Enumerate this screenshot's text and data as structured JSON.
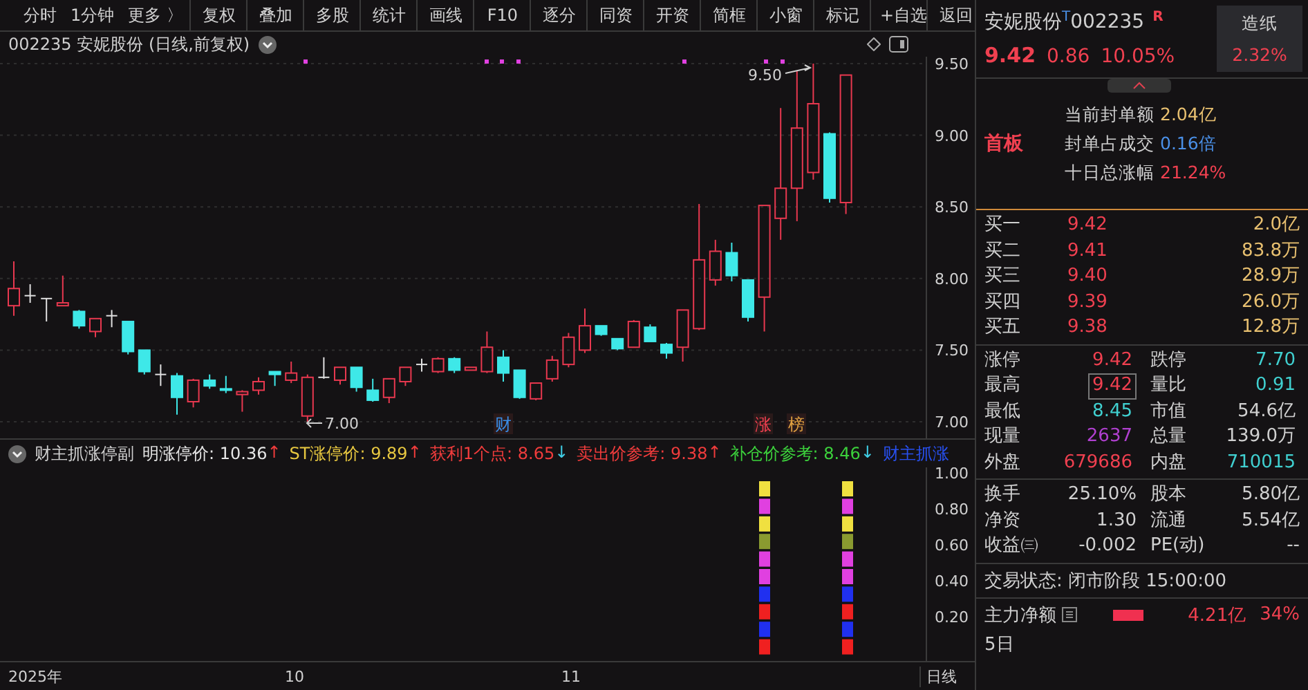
{
  "toolbar": {
    "tabs": [
      {
        "label": "分时",
        "selected": false
      },
      {
        "label": "1分钟",
        "selected": false
      },
      {
        "label": "更多 〉",
        "selected": false
      }
    ],
    "buttons": [
      "复权",
      "叠加",
      "多股",
      "统计",
      "画线",
      "F10",
      "逐分",
      "同资",
      "开资",
      "简框",
      "小窗",
      "标记",
      "+自选",
      "返回"
    ]
  },
  "chart": {
    "title": "002235 安妮股份 (日线,前复权)",
    "price_ticks": [
      "9.50",
      "9.00",
      "8.50",
      "8.00",
      "7.50",
      "7.00"
    ],
    "high_label": "9.50",
    "low_label": "7.00",
    "markers": [
      {
        "text": "财",
        "color": "#3a8ee8"
      },
      {
        "text": "涨",
        "color": "#f04050"
      },
      {
        "text": "榜",
        "color": "#e0a040"
      }
    ]
  },
  "indicator": {
    "name": "财主抓涨停副",
    "ticks": [
      "1.00",
      "0.80",
      "0.60",
      "0.40",
      "0.20"
    ],
    "items": [
      {
        "label": "明涨停价: 10.36",
        "arrow": {
          "text": "↑",
          "color": "#f03c3c"
        },
        "color": "#e6e6e6"
      },
      {
        "label": "ST涨停价: 9.89",
        "arrow": {
          "text": "↑",
          "color": "#f03c3c"
        },
        "color": "#e8c840"
      },
      {
        "label": "获利1个点: 8.65",
        "arrow": {
          "text": "↓",
          "color": "#40d0e8"
        },
        "color": "#f03c3c"
      },
      {
        "label": "卖出价参考: 9.38",
        "arrow": {
          "text": "↑",
          "color": "#f03c3c"
        },
        "color": "#f03c3c"
      },
      {
        "label": "补仓价参考: 8.46",
        "arrow": {
          "text": "↓",
          "color": "#40d0e8"
        },
        "color": "#3cd23c"
      },
      {
        "label": "财主抓涨",
        "color": "#2850f0"
      }
    ]
  },
  "date_axis": [
    "2025年",
    "10",
    "11"
  ],
  "period": "日线",
  "quote": {
    "name": "安妮股份",
    "tag": "T",
    "code": "002235",
    "badge": "R",
    "price": "9.42",
    "change": "0.86",
    "percent": "10.05%",
    "sector": {
      "name": "造纸",
      "percent": "2.32%"
    }
  },
  "seal": {
    "label": "首板",
    "rows": [
      {
        "label": "当前封单额",
        "value": "2.04亿",
        "color": "#e8c070"
      },
      {
        "label": "封单占成交",
        "value": "0.16倍",
        "color": "#4a90e8"
      },
      {
        "label": "十日总涨幅",
        "value": "21.24%",
        "color": "#f04050"
      }
    ]
  },
  "bids": [
    {
      "label": "买一",
      "price": "9.42",
      "volume": "2.0亿"
    },
    {
      "label": "买二",
      "price": "9.41",
      "volume": "83.8万"
    },
    {
      "label": "买三",
      "price": "9.40",
      "volume": "28.9万"
    },
    {
      "label": "买四",
      "price": "9.39",
      "volume": "26.0万"
    },
    {
      "label": "买五",
      "price": "9.38",
      "volume": "12.8万"
    }
  ],
  "stats": [
    {
      "label": "涨停",
      "value": "9.42",
      "color": "#f04050",
      "highlighted": false
    },
    {
      "label": "跌停",
      "value": "7.70",
      "color": "#40d0d0",
      "highlighted": false
    },
    {
      "label": "最高",
      "value": "9.42",
      "color": "#f04050",
      "highlighted": true
    },
    {
      "label": "量比",
      "value": "0.91",
      "color": "#40d0d0",
      "highlighted": false
    },
    {
      "label": "最低",
      "value": "8.45",
      "color": "#40d0d0",
      "highlighted": false
    },
    {
      "label": "市值",
      "value": "54.6亿",
      "color": "#d0d0d0",
      "highlighted": false
    },
    {
      "label": "现量",
      "value": "2637",
      "color": "#b040d0",
      "highlighted": false
    },
    {
      "label": "总量",
      "value": "139.0万",
      "color": "#d0d0d0",
      "highlighted": false
    },
    {
      "label": "外盘",
      "value": "679686",
      "color": "#f04050",
      "highlighted": false
    },
    {
      "label": "内盘",
      "value": "710015",
      "color": "#40d0d0",
      "highlighted": false
    }
  ],
  "stats2": [
    {
      "label": "换手",
      "value": "25.10%"
    },
    {
      "label": "股本",
      "value": "5.80亿"
    },
    {
      "label": "净资",
      "value": "1.30"
    },
    {
      "label": "流通",
      "value": "5.54亿"
    },
    {
      "label": "收益㈢",
      "value": "-0.002"
    },
    {
      "label": "PE(动)",
      "value": "--"
    }
  ],
  "status": "交易状态: 闭市阶段 15:00:00",
  "main_flow": {
    "label": "主力净额",
    "value": "4.21亿",
    "percent": "34%"
  },
  "five_day": "5日"
}
